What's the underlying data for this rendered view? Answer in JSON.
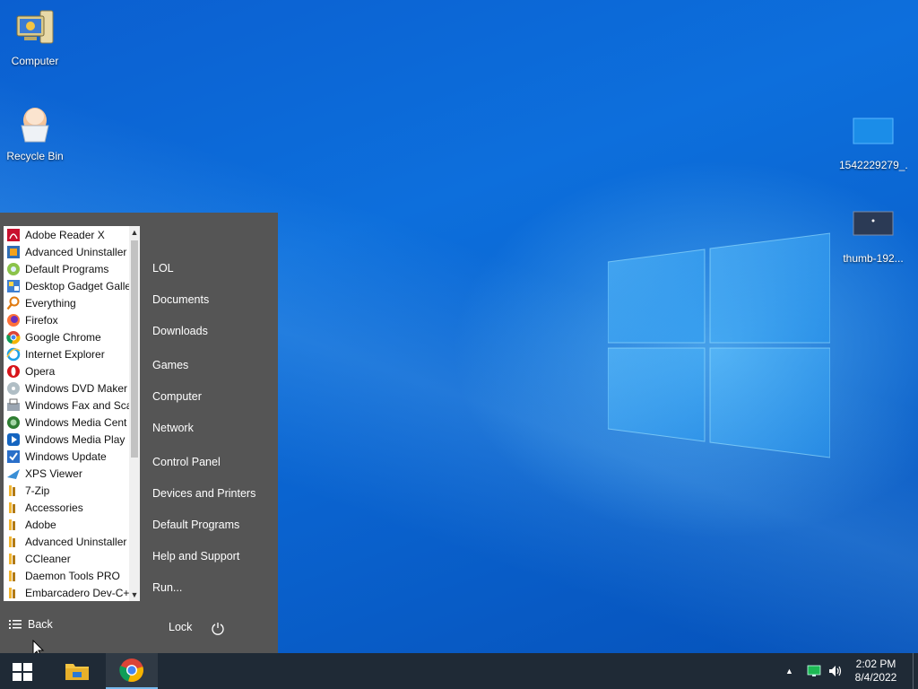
{
  "desktop": {
    "icons": [
      {
        "label": "Computer"
      },
      {
        "label": "Recycle Bin"
      },
      {
        "label": "1542229279_..."
      },
      {
        "label": "thumb-192..."
      }
    ]
  },
  "start_menu": {
    "programs": [
      {
        "label": "Adobe Reader X",
        "icon": "pdf-icon"
      },
      {
        "label": "Advanced Uninstaller",
        "icon": "uninstaller-icon"
      },
      {
        "label": "Default Programs",
        "icon": "default-programs-icon"
      },
      {
        "label": "Desktop Gadget Galle",
        "icon": "gadget-icon"
      },
      {
        "label": "Everything",
        "icon": "search-icon"
      },
      {
        "label": "Firefox",
        "icon": "firefox-icon"
      },
      {
        "label": "Google Chrome",
        "icon": "chrome-icon"
      },
      {
        "label": "Internet Explorer",
        "icon": "ie-icon"
      },
      {
        "label": "Opera",
        "icon": "opera-icon"
      },
      {
        "label": "Windows DVD Maker",
        "icon": "dvd-icon"
      },
      {
        "label": "Windows Fax and Sca",
        "icon": "fax-icon"
      },
      {
        "label": "Windows Media Cent",
        "icon": "media-center-icon"
      },
      {
        "label": "Windows Media Play",
        "icon": "media-player-icon"
      },
      {
        "label": "Windows Update",
        "icon": "update-icon"
      },
      {
        "label": "XPS Viewer",
        "icon": "xps-icon"
      },
      {
        "label": "7-Zip",
        "icon": "folder-icon"
      },
      {
        "label": "Accessories",
        "icon": "folder-icon"
      },
      {
        "label": "Adobe",
        "icon": "folder-icon"
      },
      {
        "label": "Advanced Uninstaller",
        "icon": "folder-icon"
      },
      {
        "label": "CCleaner",
        "icon": "folder-icon"
      },
      {
        "label": "Daemon Tools PRO",
        "icon": "folder-icon"
      },
      {
        "label": "Embarcadero Dev-C+",
        "icon": "folder-icon"
      }
    ],
    "places": [
      {
        "label": "LOL"
      },
      {
        "label": "Documents"
      },
      {
        "label": "Downloads"
      },
      {
        "label": "Games"
      },
      {
        "label": "Computer"
      },
      {
        "label": "Network"
      },
      {
        "label": "Control Panel"
      },
      {
        "label": "Devices and Printers"
      },
      {
        "label": "Default Programs"
      },
      {
        "label": "Help and Support"
      },
      {
        "label": "Run..."
      }
    ],
    "back_label": "Back",
    "lock_label": "Lock"
  },
  "taskbar": {
    "clock_time": "2:02 PM",
    "clock_date": "8/4/2022"
  },
  "colors": {
    "start_menu_bg": "#555555",
    "taskbar_bg": "#1f2a36",
    "accent": "#76b9ed"
  }
}
